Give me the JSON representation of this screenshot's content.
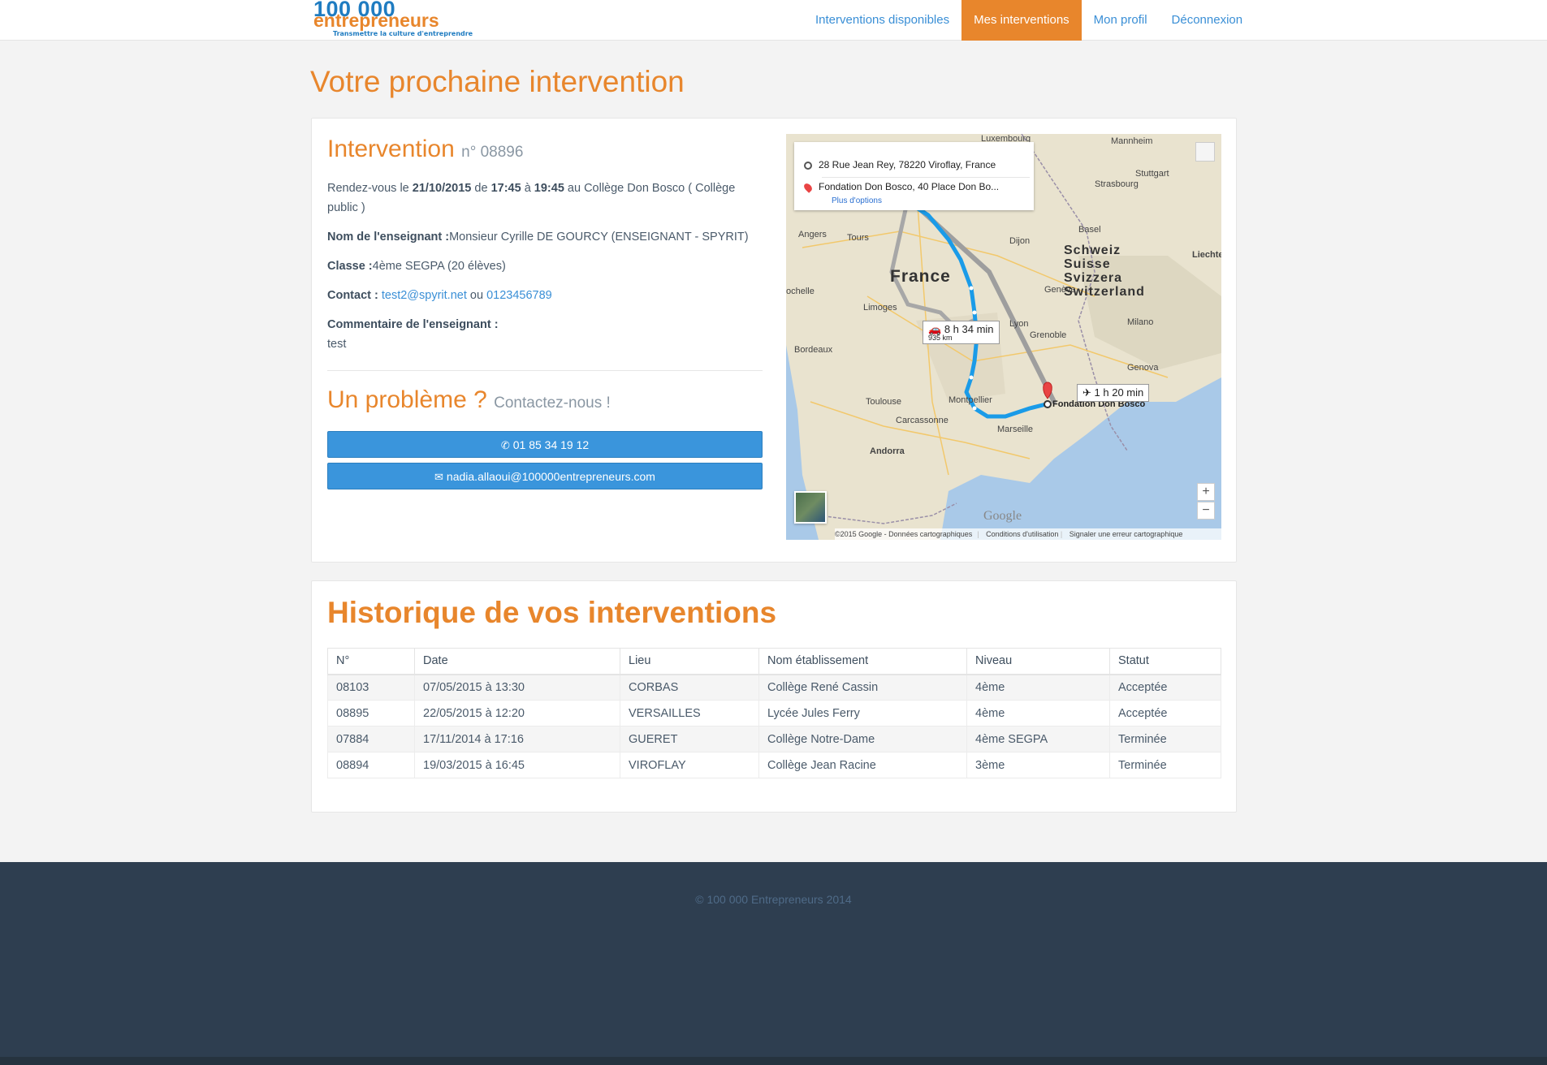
{
  "brand": {
    "logo_top": "100 000",
    "logo_mid": "entrepreneurs",
    "tagline": "Transmettre la culture d'entreprendre"
  },
  "nav": {
    "items": [
      {
        "label": "Interventions disponibles",
        "active": false
      },
      {
        "label": "Mes interventions",
        "active": true
      },
      {
        "label": "Mon profil",
        "active": false
      },
      {
        "label": "Déconnexion",
        "active": false
      }
    ]
  },
  "page_title": "Votre prochaine intervention",
  "next": {
    "title": "Intervention",
    "number": "n° 08896",
    "rdv_prefix": "Rendez-vous le",
    "rdv_date": "21/10/2015",
    "rdv_de": "de",
    "rdv_start": "17:45",
    "rdv_a": "à",
    "rdv_end": "19:45",
    "rdv_place": "au Collège Don Bosco ( Collège public )",
    "teacher_label": "Nom de l'enseignant :",
    "teacher_value": "Monsieur Cyrille DE GOURCY (ENSEIGNANT - SPYRIT)",
    "class_label": "Classe :",
    "class_value": "4ème SEGPA (20 élèves)",
    "contact_label": "Contact :",
    "contact_email": "test2@spyrit.net",
    "contact_or": "ou",
    "contact_phone": "0123456789",
    "comment_label": "Commentaire de l'enseignant :",
    "comment_value": "test"
  },
  "problem": {
    "title": "Un problème ?",
    "subtitle": "Contactez-nous !",
    "phone_button": "01 85 34 19 12",
    "email_button": "nadia.allaoui@100000entrepreneurs.com"
  },
  "map": {
    "origin": "28 Rue Jean Rey, 78220 Viroflay, France",
    "destination": "Fondation Don Bosco, 40 Place Don Bo...",
    "more_options": "Plus d'options",
    "drive_time": "8 h 34 min",
    "drive_distance": "935 km",
    "flight_time": "1 h 20 min",
    "dest_label": "Fondation Don Bosco",
    "country_label": "France",
    "swiss_label_1": "Schweiz",
    "swiss_label_2": "Suisse",
    "swiss_label_3": "Svizzera",
    "swiss_label_4": "Switzerland",
    "cities": {
      "luxembourg": "Luxembourg",
      "mannheim": "Mannheim",
      "stuttgart": "Stuttgart",
      "strasbourg": "Strasbourg",
      "basel": "Basel",
      "dijon": "Dijon",
      "angers": "Angers",
      "tours": "Tours",
      "geneve": "Genève",
      "lyon": "Lyon",
      "limoges": "Limoges",
      "grenoble": "Grenoble",
      "milano": "Milano",
      "bordeaux": "Bordeaux",
      "genova": "Genova",
      "toulouse": "Toulouse",
      "montpellier": "Montpellier",
      "carcassonne": "Carcassonne",
      "marseille": "Marseille",
      "andorra": "Andorra",
      "rochelle": "ochelle",
      "liechtenstein": "Liechter"
    },
    "zoom_in": "+",
    "zoom_out": "−",
    "google": "Google",
    "footer_copyright": "©2015 Google - Données cartographiques",
    "footer_terms": "Conditions d'utilisation",
    "footer_report": "Signaler une erreur cartographique"
  },
  "history": {
    "title": "Historique de vos interventions",
    "columns": [
      "N°",
      "Date",
      "Lieu",
      "Nom établissement",
      "Niveau",
      "Statut"
    ],
    "rows": [
      [
        "08103",
        "07/05/2015 à 13:30",
        "CORBAS",
        "Collège René Cassin",
        "4ème",
        "Acceptée"
      ],
      [
        "08895",
        "22/05/2015 à 12:20",
        "VERSAILLES",
        "Lycée Jules Ferry",
        "4ème",
        "Acceptée"
      ],
      [
        "07884",
        "17/11/2014 à 17:16",
        "GUERET",
        "Collège Notre-Dame",
        "4ème SEGPA",
        "Terminée"
      ],
      [
        "08894",
        "19/03/2015 à 16:45",
        "VIROFLAY",
        "Collège Jean Racine",
        "3ème",
        "Terminée"
      ]
    ]
  },
  "footer": {
    "copyright": "© 100 000 Entrepreneurs 2014"
  },
  "colors": {
    "accent": "#e8862c",
    "link": "#3a8fd6",
    "button": "#3a95dc",
    "footer_bg": "#2e3e50",
    "route": "#1a9be8"
  },
  "icons": {
    "phone_button_icon": "phone-icon",
    "email_button_icon": "envelope-icon"
  }
}
